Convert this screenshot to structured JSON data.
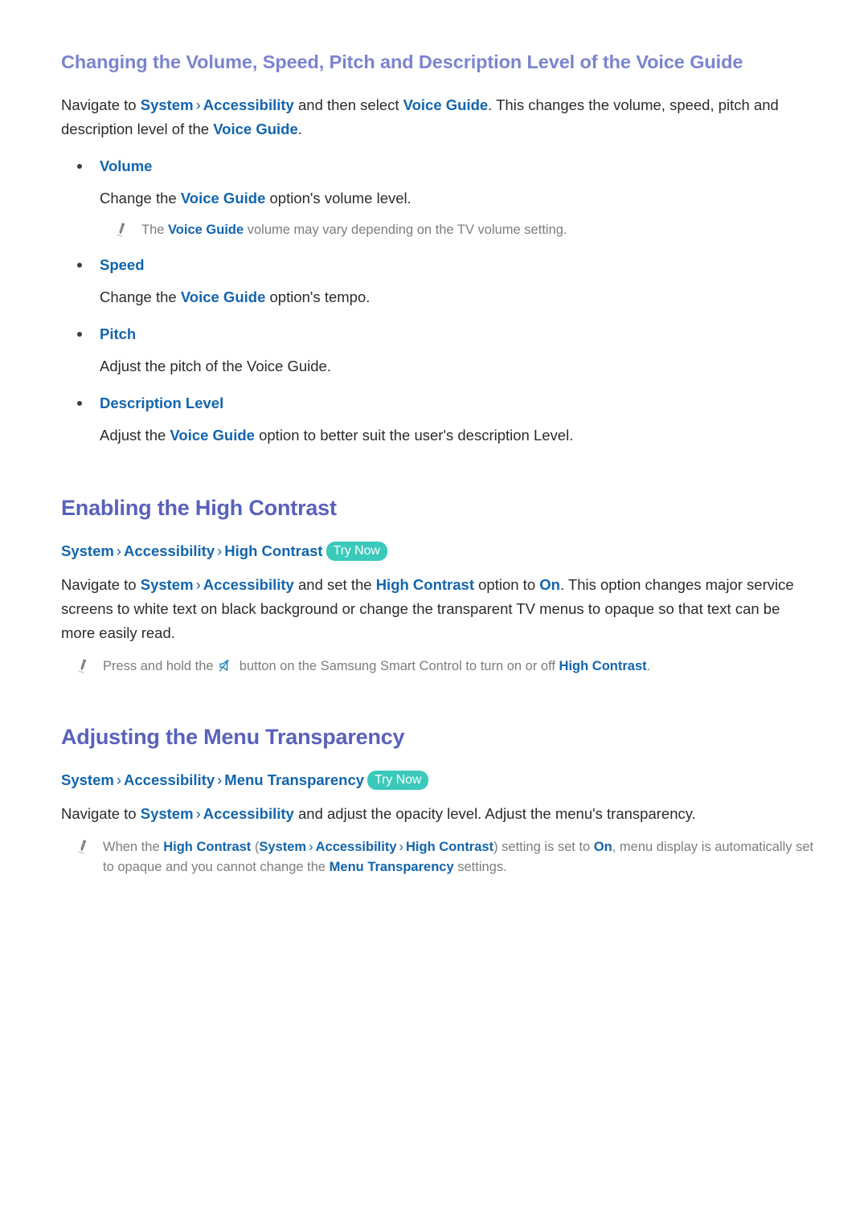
{
  "page": {
    "background": "#ffffff",
    "accent_heading_color": "#5861bd",
    "link_color": "#1265ae",
    "body_color": "#2b2b2b",
    "note_color": "#7d7d7d",
    "badge_color": "#3ac9bb"
  },
  "topic": {
    "title": "Changing the Volume, Speed, Pitch and Description Level of the Voice Guide",
    "intro": {
      "t1": "Navigate to ",
      "link1": "System",
      "sep1": "›",
      "link2": "Accessibility",
      "t2": " and then select ",
      "link3": "Voice Guide",
      "t3": ". This changes the volume, speed, pitch and description level of the ",
      "link4": "Voice Guide",
      "t4": "."
    },
    "bullets": [
      {
        "label": "Volume",
        "desc_pre": "Change the ",
        "desc_link": "Voice Guide",
        "desc_post": " option's volume level.",
        "note": {
          "pre": "The ",
          "link": "Voice Guide",
          "post": " volume may vary depending on the TV volume setting.",
          "icon": "pencil-icon"
        }
      },
      {
        "label": "Speed",
        "desc_pre": "Change the ",
        "desc_link": "Voice Guide",
        "desc_post": " option's tempo."
      },
      {
        "label": "Pitch",
        "desc_pre": "Adjust the pitch of the Voice Guide.",
        "desc_link": "",
        "desc_post": ""
      },
      {
        "label": "Description Level",
        "desc_pre": "Adjust the ",
        "desc_link": "Voice Guide",
        "desc_post": " option to better suit the user's description Level."
      }
    ]
  },
  "section_high_contrast": {
    "title": "Enabling the High Contrast",
    "path": {
      "item1": "System",
      "sep1": "›",
      "item2": "Accessibility",
      "sep2": "›",
      "item3": "High Contrast",
      "badge": "Try Now"
    },
    "body": {
      "t1": "Navigate to ",
      "link1": "System",
      "sep1": "›",
      "link2": "Accessibility",
      "t2": " and set the ",
      "link3": "High Contrast",
      "t3": " option to ",
      "link4": "On",
      "t4": ". This option changes major service screens to white text on black background or change the transparent TV menus to opaque so that text can be more easily read."
    },
    "note": {
      "icon": "pencil-icon",
      "pre": "Press and hold the ",
      "button_icon": "mute-icon",
      "mid": " button on the Samsung Smart Control to turn on or off ",
      "link": "High Contrast",
      "post": "."
    }
  },
  "section_menu_transparency": {
    "title": "Adjusting the Menu Transparency",
    "path": {
      "item1": "System",
      "sep1": "›",
      "item2": "Accessibility",
      "sep2": "›",
      "item3": "Menu Transparency",
      "badge": "Try Now"
    },
    "body": {
      "t1": "Navigate to ",
      "link1": "System",
      "sep1": "›",
      "link2": "Accessibility",
      "t2": " and adjust the opacity level. Adjust the menu's transparency."
    },
    "note": {
      "icon": "pencil-icon",
      "t1": "When the ",
      "link1": "High Contrast",
      "t2": " (",
      "link2": "System",
      "sep1": "›",
      "link3": "Accessibility",
      "sep2": "›",
      "link4": "High Contrast",
      "t3": ") setting is set to ",
      "link5": "On",
      "t4": ", menu display is automatically set to opaque and you cannot change the ",
      "link6": "Menu Transparency",
      "t5": " settings."
    }
  }
}
